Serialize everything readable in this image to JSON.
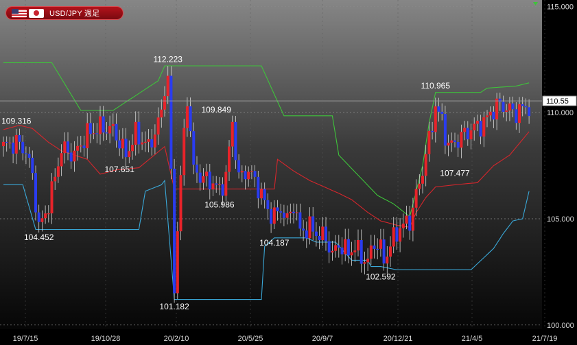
{
  "header": {
    "pair_label": "USD/JPY 週足",
    "base_flag": "us-flag-icon",
    "quote_flag": "jp-flag-icon"
  },
  "colors": {
    "up": "#e8232a",
    "down": "#2a3cf0",
    "upper_band": "#3ec43a",
    "middle_band": "#d6262c",
    "lower_band": "#3aa8d8",
    "price_line": "#9a9a9a"
  },
  "chart_data": {
    "type": "candlestick",
    "x_tick_labels": [
      "19/7/15",
      "19/10/28",
      "20/2/10",
      "20/5/25",
      "20/9/7",
      "20/12/21",
      "21/4/5",
      "21/7/19"
    ],
    "y_tick_labels": [
      "115.000",
      "110.000",
      "105.000",
      "100.000"
    ],
    "ylim": [
      99.8,
      115.3
    ],
    "current_price_label": "110.55",
    "annotations": [
      {
        "text": "112.223",
        "x": 51,
        "y": 112.223,
        "pos": "above"
      },
      {
        "text": "109.316",
        "x": 4,
        "y": 109.316,
        "pos": "above"
      },
      {
        "text": "109.849",
        "x": 66,
        "y": 109.849,
        "pos": "above"
      },
      {
        "text": "107.651",
        "x": 36,
        "y": 107.651,
        "pos": "below"
      },
      {
        "text": "104.452",
        "x": 11,
        "y": 104.452,
        "pos": "below"
      },
      {
        "text": "105.986",
        "x": 67,
        "y": 105.986,
        "pos": "below"
      },
      {
        "text": "104.187",
        "x": 84,
        "y": 104.187,
        "pos": "below"
      },
      {
        "text": "101.182",
        "x": 53,
        "y": 101.182,
        "pos": "below"
      },
      {
        "text": "102.592",
        "x": 117,
        "y": 102.592,
        "pos": "below"
      },
      {
        "text": "110.965",
        "x": 134,
        "y": 110.965,
        "pos": "above"
      },
      {
        "text": "107.477",
        "x": 140,
        "y": 107.477,
        "pos": "below"
      }
    ],
    "series": [
      {
        "name": "upper",
        "values": [
          [
            0,
            112.35
          ],
          [
            15,
            112.35
          ],
          [
            24,
            110.1
          ],
          [
            34,
            110.1
          ],
          [
            48,
            111.5
          ],
          [
            50,
            112.2
          ],
          [
            80,
            112.2
          ],
          [
            87,
            109.85
          ],
          [
            102,
            109.85
          ],
          [
            104,
            108.0
          ],
          [
            116,
            106.1
          ],
          [
            121,
            105.7
          ],
          [
            126,
            105.1
          ],
          [
            130,
            107.5
          ],
          [
            132,
            109.5
          ],
          [
            134,
            110.95
          ],
          [
            148,
            110.95
          ],
          [
            150,
            111.15
          ],
          [
            159,
            111.25
          ],
          [
            163,
            111.4
          ]
        ]
      },
      {
        "name": "middle",
        "values": [
          [
            0,
            109.2
          ],
          [
            5,
            109.4
          ],
          [
            9,
            109.25
          ],
          [
            14,
            108.6
          ],
          [
            18,
            108.2
          ],
          [
            26,
            107.8
          ],
          [
            30,
            107.1
          ],
          [
            35,
            107.3
          ],
          [
            42,
            107.4
          ],
          [
            46,
            107.9
          ],
          [
            50,
            108.4
          ],
          [
            53,
            106.4
          ],
          [
            66,
            106.4
          ],
          [
            84,
            106.4
          ],
          [
            85,
            107.8
          ],
          [
            90,
            107.25
          ],
          [
            95,
            106.8
          ],
          [
            104,
            106.2
          ],
          [
            108,
            105.9
          ],
          [
            113,
            105.3
          ],
          [
            117,
            104.9
          ],
          [
            122,
            104.7
          ],
          [
            126,
            104.6
          ],
          [
            128,
            105.3
          ],
          [
            131,
            106.0
          ],
          [
            134,
            106.5
          ],
          [
            140,
            106.6
          ],
          [
            147,
            106.7
          ],
          [
            152,
            107.5
          ],
          [
            157,
            108.0
          ],
          [
            163,
            109.1
          ]
        ]
      },
      {
        "name": "lower",
        "values": [
          [
            0,
            106.6
          ],
          [
            6,
            106.6
          ],
          [
            10,
            104.5
          ],
          [
            20,
            104.5
          ],
          [
            42,
            104.5
          ],
          [
            44,
            106.3
          ],
          [
            49,
            106.6
          ],
          [
            50,
            106.8
          ],
          [
            53,
            101.2
          ],
          [
            80,
            101.2
          ],
          [
            81,
            103.7
          ],
          [
            84,
            104.1
          ],
          [
            94,
            104.1
          ],
          [
            97,
            103.9
          ],
          [
            103,
            103.9
          ],
          [
            108,
            103.05
          ],
          [
            113,
            103.05
          ],
          [
            114,
            102.75
          ],
          [
            117,
            102.75
          ],
          [
            122,
            102.6
          ],
          [
            141,
            102.6
          ],
          [
            145,
            102.6
          ],
          [
            152,
            103.6
          ],
          [
            155,
            104.3
          ],
          [
            158,
            104.9
          ],
          [
            161,
            105.0
          ],
          [
            163,
            106.3
          ]
        ]
      }
    ]
  }
}
